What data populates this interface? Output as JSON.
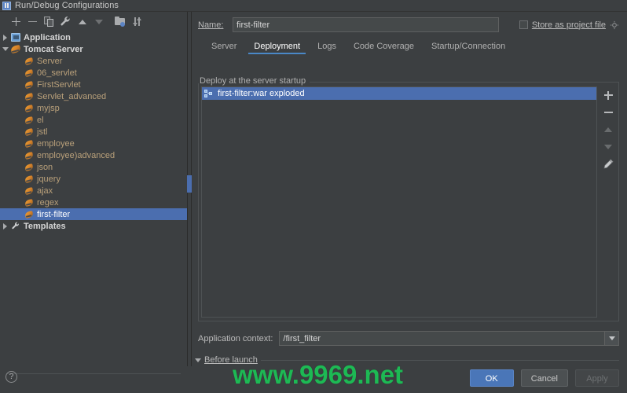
{
  "window": {
    "title": "Run/Debug Configurations",
    "icon": "run-debug-icon"
  },
  "toolbar": {
    "buttons": [
      {
        "name": "add",
        "icon": "plus-icon"
      },
      {
        "name": "remove",
        "icon": "minus-icon"
      },
      {
        "name": "copy",
        "icon": "copy-icon"
      },
      {
        "name": "edit-templates",
        "icon": "wrench-icon"
      },
      {
        "name": "move-up",
        "icon": "arrow-up-icon"
      },
      {
        "name": "move-down",
        "icon": "arrow-down-icon"
      },
      {
        "name": "move-into-folder",
        "icon": "folder-icon"
      },
      {
        "name": "sort",
        "icon": "sort-icon"
      }
    ]
  },
  "tree": {
    "items": [
      {
        "label": "Application",
        "icon": "application-icon",
        "level": 0,
        "twisty": "collapsed",
        "root": true,
        "selected": false
      },
      {
        "label": "Tomcat Server",
        "icon": "tomcat-icon",
        "level": 0,
        "twisty": "expanded",
        "root": true,
        "selected": false
      },
      {
        "label": "Server",
        "icon": "tomcat-small-icon",
        "level": 1,
        "twisty": "none",
        "root": false,
        "selected": false
      },
      {
        "label": "06_servlet",
        "icon": "tomcat-small-icon",
        "level": 1,
        "twisty": "none",
        "root": false,
        "selected": false
      },
      {
        "label": "FirstServlet",
        "icon": "tomcat-small-icon",
        "level": 1,
        "twisty": "none",
        "root": false,
        "selected": false
      },
      {
        "label": "Servlet_advanced",
        "icon": "tomcat-small-icon",
        "level": 1,
        "twisty": "none",
        "root": false,
        "selected": false
      },
      {
        "label": "myjsp",
        "icon": "tomcat-small-icon",
        "level": 1,
        "twisty": "none",
        "root": false,
        "selected": false
      },
      {
        "label": "el",
        "icon": "tomcat-small-icon",
        "level": 1,
        "twisty": "none",
        "root": false,
        "selected": false
      },
      {
        "label": "jstl",
        "icon": "tomcat-small-icon",
        "level": 1,
        "twisty": "none",
        "root": false,
        "selected": false
      },
      {
        "label": "employee",
        "icon": "tomcat-small-icon",
        "level": 1,
        "twisty": "none",
        "root": false,
        "selected": false
      },
      {
        "label": "employee)advanced",
        "icon": "tomcat-small-icon",
        "level": 1,
        "twisty": "none",
        "root": false,
        "selected": false
      },
      {
        "label": "json",
        "icon": "tomcat-small-icon",
        "level": 1,
        "twisty": "none",
        "root": false,
        "selected": false
      },
      {
        "label": "jquery",
        "icon": "tomcat-small-icon",
        "level": 1,
        "twisty": "none",
        "root": false,
        "selected": false
      },
      {
        "label": "ajax",
        "icon": "tomcat-small-icon",
        "level": 1,
        "twisty": "none",
        "root": false,
        "selected": false
      },
      {
        "label": "regex",
        "icon": "tomcat-small-icon",
        "level": 1,
        "twisty": "none",
        "root": false,
        "selected": false
      },
      {
        "label": "first-filter",
        "icon": "tomcat-small-icon",
        "level": 1,
        "twisty": "none",
        "root": false,
        "selected": true
      },
      {
        "label": "Templates",
        "icon": "wrench-icon",
        "level": 0,
        "twisty": "collapsed",
        "root": true,
        "selected": false
      }
    ]
  },
  "name_field": {
    "label": "Name:",
    "value": "first-filter",
    "placeholder": ""
  },
  "store_as_project_file": {
    "label": "Store as project file",
    "checked": false,
    "gear_icon": "gear-icon"
  },
  "tabs": [
    {
      "label": "Server",
      "active": false
    },
    {
      "label": "Deployment",
      "active": true
    },
    {
      "label": "Logs",
      "active": false
    },
    {
      "label": "Code Coverage",
      "active": false
    },
    {
      "label": "Startup/Connection",
      "active": false
    }
  ],
  "deployment": {
    "group_label": "Deploy at the server startup",
    "items": [
      {
        "label": "first-filter:war exploded",
        "icon": "artifact-icon",
        "selected": true
      }
    ],
    "side_buttons": [
      {
        "name": "add-artifact",
        "icon": "plus-icon",
        "enabled": true
      },
      {
        "name": "remove-artifact",
        "icon": "minus-icon",
        "enabled": true
      },
      {
        "name": "move-artifact-up",
        "icon": "arrow-up-icon",
        "enabled": false
      },
      {
        "name": "move-artifact-down",
        "icon": "arrow-down-icon",
        "enabled": false
      },
      {
        "name": "edit-artifact",
        "icon": "pencil-icon",
        "enabled": true
      }
    ]
  },
  "application_context": {
    "label": "Application context:",
    "value": "/first_filter"
  },
  "before_launch": {
    "label": "Before launch",
    "expanded": true
  },
  "bottom": {
    "help_label": "?",
    "ok_label": "OK",
    "cancel_label": "Cancel",
    "apply_label": "Apply",
    "apply_enabled": false
  },
  "watermark": {
    "text": "www.9969.net",
    "color": "#1db954"
  },
  "colors": {
    "background": "#3c3f41",
    "selection": "#4b6eaf",
    "tab_accent": "#4a88c7",
    "tree_item_text": "#b9a07a",
    "primary_button": "#4a76b8"
  }
}
